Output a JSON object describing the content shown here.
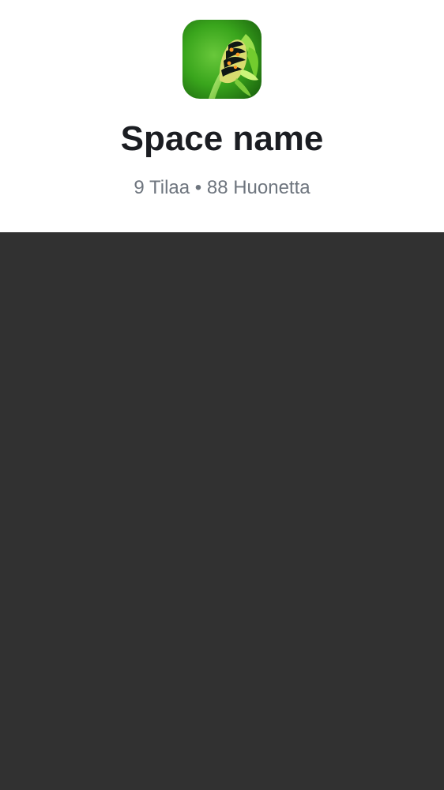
{
  "space": {
    "name": "Space name",
    "stats": "9 Tilaa • 88 Huonetta",
    "avatar": {
      "icon": "caterpillar-avatar-icon"
    }
  },
  "colors": {
    "header_background": "#ffffff",
    "title": "#1b1d22",
    "subtitle": "#6e757e",
    "overlay": "#313131"
  }
}
